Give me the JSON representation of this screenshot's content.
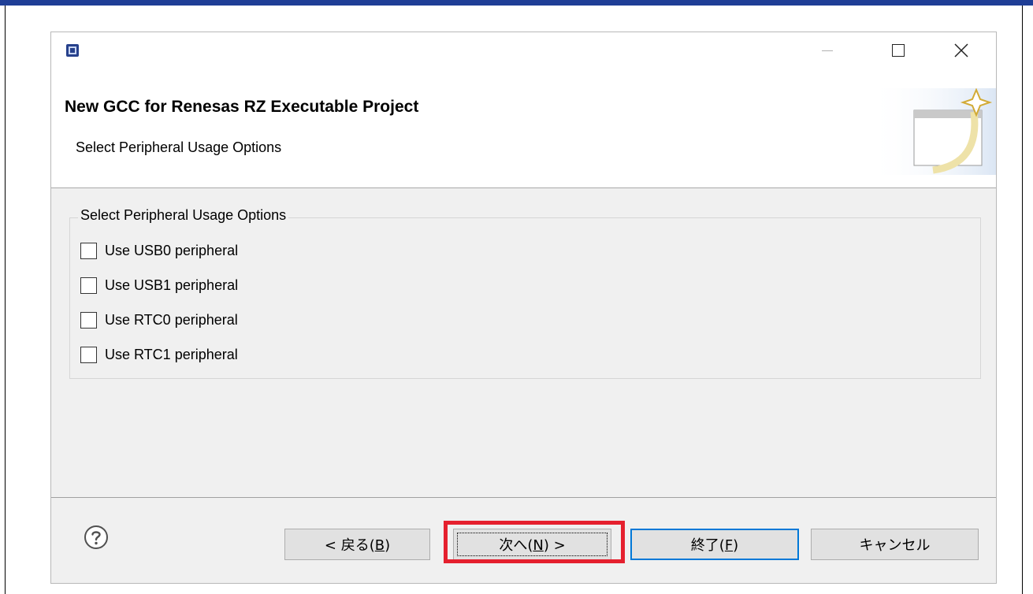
{
  "dialog": {
    "title": "New GCC for Renesas RZ Executable Project",
    "subtitle": "Select Peripheral Usage Options"
  },
  "group": {
    "legend": "Select Peripheral Usage Options",
    "options": [
      {
        "label": "Use USB0 peripheral",
        "checked": false
      },
      {
        "label": "Use USB1 peripheral",
        "checked": false
      },
      {
        "label": "Use RTC0 peripheral",
        "checked": false
      },
      {
        "label": "Use RTC1 peripheral",
        "checked": false
      }
    ]
  },
  "buttons": {
    "back_text": "< 戻る(",
    "back_key": "B",
    "back_end": ")",
    "next_text": "次へ(",
    "next_key": "N",
    "next_end": ") >",
    "finish_text": "終了(",
    "finish_key": "F",
    "finish_end": ")",
    "cancel": "キャンセル"
  },
  "icons": {
    "app": "chip-icon",
    "minimize": "minimize-icon",
    "maximize": "maximize-icon",
    "close": "close-icon",
    "banner": "wizard-banner-icon",
    "help": "help-icon"
  },
  "colors": {
    "top_rule": "#1f3e96",
    "highlight": "#e5202e",
    "default_button_border": "#0078d7"
  }
}
